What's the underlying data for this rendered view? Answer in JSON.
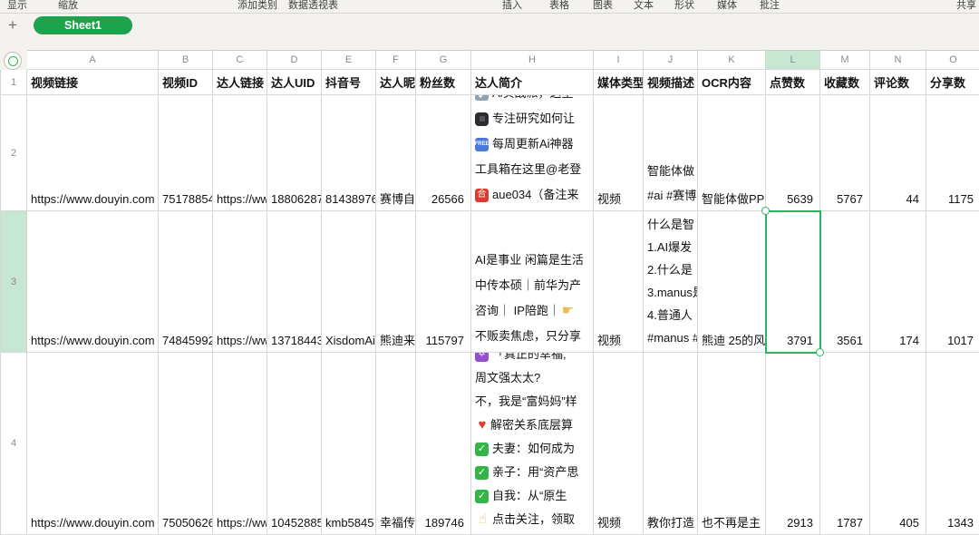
{
  "toolbar": {
    "items": [
      "显示",
      "缩放",
      "添加类别",
      "数据透视表",
      "插入",
      "表格",
      "图表",
      "文本",
      "形状",
      "媒体",
      "批注",
      "共享"
    ]
  },
  "tab_bar": {
    "add_sheet_label": "+",
    "sheet_name": "Sheet1"
  },
  "colors": {
    "sheet_tab_green": "#1ea24b",
    "selection_green": "#2eb45b",
    "header_highlight_green": "#c8e7d2",
    "gridline": "#d8d7d4"
  },
  "grid": {
    "column_letters": [
      "A",
      "B",
      "C",
      "D",
      "E",
      "F",
      "G",
      "H",
      "I",
      "J",
      "K",
      "L",
      "M",
      "N",
      "O"
    ],
    "selected_cell": {
      "column": "L",
      "row": "3"
    },
    "header_row": {
      "num": "1",
      "cells": {
        "A": "视频链接",
        "B": "视频ID",
        "C": "达人链接",
        "D": "达人UID",
        "E": "抖音号",
        "F": "达人昵称",
        "G": "粉丝数",
        "H": "达人简介",
        "I": "媒体类型",
        "J": "视频描述",
        "K": "OCR内容",
        "L": "点赞数",
        "M": "收藏数",
        "N": "评论数",
        "O": "分享数"
      }
    },
    "rows": [
      {
        "num": "2",
        "cells": {
          "A": {
            "t": "https://www.douyin.com"
          },
          "B": {
            "t": "75178854"
          },
          "C": {
            "t": "https://www"
          },
          "D": {
            "t": "18806287"
          },
          "E": {
            "t": "81438976"
          },
          "F": {
            "t": "赛博自"
          },
          "G": {
            "t": "26566"
          },
          "H": {
            "lines": [
              [
                {
                  "icon": "microscope-emoji"
                },
                {
                  "t": "Ai实战派，这里"
                }
              ],
              [
                {
                  "icon": "watch-emoji"
                },
                {
                  "t": "专注研究如何让"
                }
              ],
              [
                {
                  "icon": "free-emoji"
                },
                {
                  "t": "每周更新Ai神器"
                }
              ],
              [
                {
                  "t": "工具箱在这里@老登"
                }
              ],
              [
                {
                  "icon": "he-mark-emoji"
                },
                {
                  "t": "aue034（备注来"
                }
              ]
            ]
          },
          "I": {
            "t": "视频"
          },
          "J": {
            "lines": [
              [
                {
                  "t": "智能体做"
                }
              ],
              [
                {
                  "t": "#ai #赛博"
                }
              ]
            ]
          },
          "K": {
            "t": "智能体做PP"
          },
          "L": {
            "t": "5639"
          },
          "M": {
            "t": "5767"
          },
          "N": {
            "t": "44"
          },
          "O": {
            "t": "1175"
          }
        }
      },
      {
        "num": "3",
        "cells": {
          "A": {
            "t": "https://www.douyin.com"
          },
          "B": {
            "t": "74845992"
          },
          "C": {
            "t": "https://www"
          },
          "D": {
            "t": "13718443"
          },
          "E": {
            "t": "XisdomAi"
          },
          "F": {
            "t": "熊迪来"
          },
          "G": {
            "t": "115797"
          },
          "H": {
            "lines": [
              [
                {
                  "t": "AI是事业 闲篇是生活"
                }
              ],
              [
                {
                  "t": "中传本硕｜前华为产"
                }
              ],
              [
                {
                  "t": "咨询｜ IP陪跑｜"
                },
                {
                  "icon": "point-right-emoji"
                }
              ],
              [
                {
                  "t": "不贩卖焦虑，只分享"
                }
              ]
            ]
          },
          "I": {
            "t": "视频"
          },
          "J": {
            "lines": [
              [
                {
                  "t": "什么是智"
                }
              ],
              [
                {
                  "t": "1.AI爆发"
                }
              ],
              [
                {
                  "t": "2.什么是"
                }
              ],
              [
                {
                  "t": "3.manus是"
                }
              ],
              [
                {
                  "t": "4.普通人"
                }
              ],
              [
                {
                  "t": "#manus #"
                }
              ]
            ]
          },
          "K": {
            "t": "熊迪 25的风"
          },
          "L": {
            "t": "3791"
          },
          "M": {
            "t": "3561"
          },
          "N": {
            "t": "174"
          },
          "O": {
            "t": "1017"
          }
        }
      },
      {
        "num": "4",
        "cells": {
          "A": {
            "t": "https://www.douyin.com"
          },
          "B": {
            "t": "75050626"
          },
          "C": {
            "t": "https://www"
          },
          "D": {
            "t": "10452885"
          },
          "E": {
            "t": "kmb5845"
          },
          "F": {
            "t": "幸福传"
          },
          "G": {
            "t": "189746"
          },
          "H": {
            "lines": [
              [
                {
                  "icon": "star-of-david-emoji"
                },
                {
                  "t": "「真正的幸福,"
                }
              ],
              [
                {
                  "t": "周文强太太?"
                }
              ],
              [
                {
                  "t": "不，我是“富妈妈”样"
                }
              ],
              [
                {
                  "icon": "heart-emoji"
                },
                {
                  "t": "解密关系底层算"
                }
              ],
              [
                {
                  "icon": "check-emoji"
                },
                {
                  "t": "夫妻：如何成为"
                }
              ],
              [
                {
                  "icon": "check-emoji"
                },
                {
                  "t": "亲子：用“资产思"
                }
              ],
              [
                {
                  "icon": "check-emoji"
                },
                {
                  "t": "自我：从“原生"
                }
              ],
              [
                {
                  "icon": "point-up-emoji"
                },
                {
                  "t": "点击关注，领取"
                }
              ]
            ]
          },
          "I": {
            "t": "视频"
          },
          "J": {
            "t": "教你打造"
          },
          "K": {
            "t": "也不再是主"
          },
          "L": {
            "t": "2913"
          },
          "M": {
            "t": "1787"
          },
          "N": {
            "t": "405"
          },
          "O": {
            "t": "1343"
          }
        }
      }
    ]
  }
}
